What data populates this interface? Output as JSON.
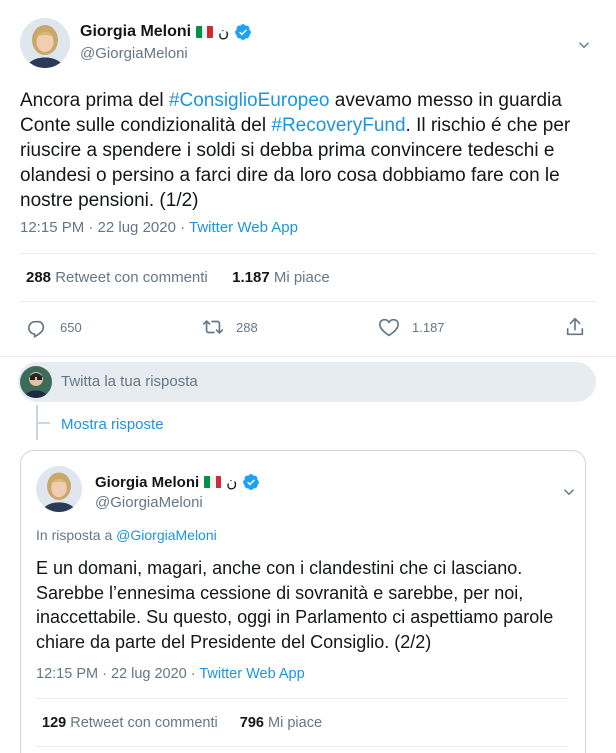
{
  "main_tweet": {
    "author_name": "Giorgia Meloni",
    "arabic_glyph": "ن",
    "handle": "@GiorgiaMeloni",
    "text_parts": [
      {
        "t": "Ancora prima del ",
        "tag": false
      },
      {
        "t": "#ConsiglioEuropeo",
        "tag": true
      },
      {
        "t": " avevamo messo in guardia Conte sulle condizionalità del ",
        "tag": false
      },
      {
        "t": "#RecoveryFund",
        "tag": true
      },
      {
        "t": ". Il rischio é che per riuscire a spendere i soldi si debba prima convincere tedeschi e olandesi o persino a farci dire da loro cosa dobbiamo fare con le nostre pensioni. (1/2)",
        "tag": false
      }
    ],
    "time": "12:15 PM · 22 lug 2020 · ",
    "app": "Twitter Web App",
    "retweets_count": "288",
    "retweets_label": "Retweet con commenti",
    "likes_count": "1.187",
    "likes_label": "Mi piace",
    "actions": {
      "reply_count": "650",
      "retweet_count": "288",
      "like_count": "1.187"
    }
  },
  "reply_box": {
    "placeholder": "Twitta la tua risposta"
  },
  "show_replies": "Mostra risposte",
  "reply_tweet": {
    "author_name": "Giorgia Meloni",
    "arabic_glyph": "ن",
    "handle": "@GiorgiaMeloni",
    "in_reply_prefix": "In risposta a ",
    "in_reply_handle": "@GiorgiaMeloni",
    "text": "E un domani, magari, anche con i clandestini che ci lasciano. Sarebbe l’ennesima cessione di sovranità e sarebbe, per noi, inaccettabile. Su questo, oggi in Parlamento ci aspettiamo parole chiare da parte del Presidente del Consiglio. (2/2)",
    "time": "12:15 PM · 22 lug 2020 · ",
    "app": "Twitter Web App",
    "retweets_count": "129",
    "retweets_label": "Retweet con commenti",
    "likes_count": "796",
    "likes_label": "Mi piace"
  },
  "colors": {
    "link": "#1b95e0",
    "muted": "#657786",
    "divider": "#e6ecf0"
  },
  "icons": [
    "chevron-down-icon",
    "verified-badge-icon",
    "italy-flag-icon",
    "reply-icon",
    "retweet-icon",
    "like-icon",
    "share-icon"
  ]
}
